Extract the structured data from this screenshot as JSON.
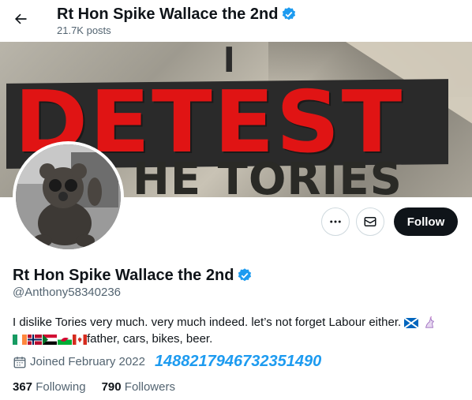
{
  "header": {
    "title": "Rt Hon Spike Wallace the 2nd",
    "posts": "21.7K posts"
  },
  "banner": {
    "line1": "I",
    "line2": "DETEST",
    "line3": "HE TORIES"
  },
  "actions": {
    "more_icon": "more-horizontal-icon",
    "message_icon": "mail-icon",
    "follow_label": "Follow"
  },
  "profile": {
    "name": "Rt Hon Spike Wallace the 2nd",
    "handle": "@Anthony58340236",
    "bio_line1": "I dislike Tories very much. very much indeed. let’s not forget Labour either.",
    "bio_line2": "father, cars, bikes, beer.",
    "joined": "Joined February 2022",
    "overlay_number": "1488217946732351490",
    "following_count": "367",
    "following_label": "Following",
    "followers_count": "790",
    "followers_label": "Followers"
  },
  "colors": {
    "verified": "#1d9bf0",
    "follow_bg": "#0f1419",
    "banner_red": "#e01414"
  }
}
